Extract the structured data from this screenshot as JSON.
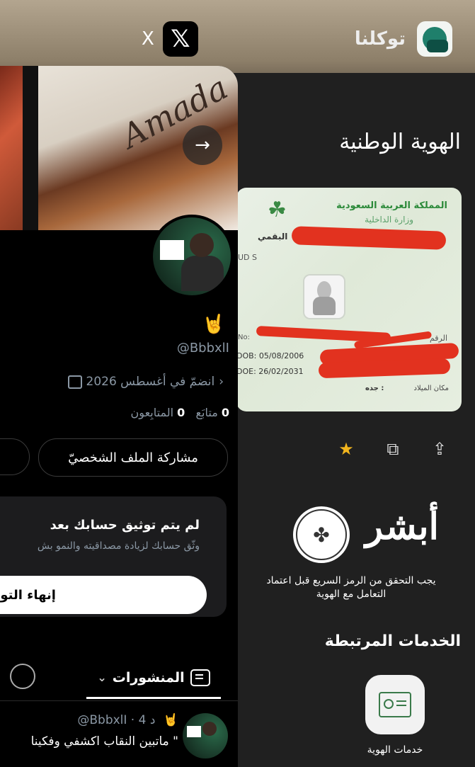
{
  "switcher": {
    "twitter_close": "X",
    "twitter_logo": "𝕏",
    "tawakkalna_name": "توكلنا"
  },
  "tawakkalna": {
    "title": "الهوية الوطنية",
    "id_card": {
      "kingdom": "المملكة العربية السعودية",
      "ministry": "وزارة الداخلية",
      "name_ar": "البقمي",
      "name_en_partial": "UD S",
      "number_label_en": "No:",
      "number_label_ar": "الرقم",
      "dob": "DOB: 05/08/2006",
      "doe": "DOE: 26/02/2031",
      "birthplace_label": "مكان الميلاد",
      "birthplace_value": ": جده"
    },
    "actions": [
      "share-icon",
      "copy-icon",
      "star-icon"
    ],
    "absher_logo": "أبشر",
    "verify_notice": "يجب التحقق من الرمز السريع قبل اعتماد التعامل مع الهوية",
    "related_services_title": "الخدمات المرتبطة",
    "service_label": "خدمات الهوية"
  },
  "twitter": {
    "banner_text": "Amada",
    "emoji": "🤘",
    "handle": "@BbbxlI",
    "joined": "انضمّ في أغسطس 2026",
    "following_count": "0",
    "following_label": "متابَع",
    "followers_count": "0",
    "followers_label": "المتابِعون",
    "share_profile": "مشاركة الملف الشخصيّ",
    "other_button_partial": "ت",
    "verify_title": "لم يتم توثيق حسابك بعد",
    "verify_sub": "وثّق حسابك لزيادة مصداقيته والنمو بش",
    "verify_button": "إنهاء التوثيق",
    "tab_posts": "المنشورات",
    "post": {
      "meta": "@BbbxlI · 4 د",
      "emoji": "🤘",
      "text": "\" ماتبين النقاب اكشفي وفكينا"
    }
  }
}
